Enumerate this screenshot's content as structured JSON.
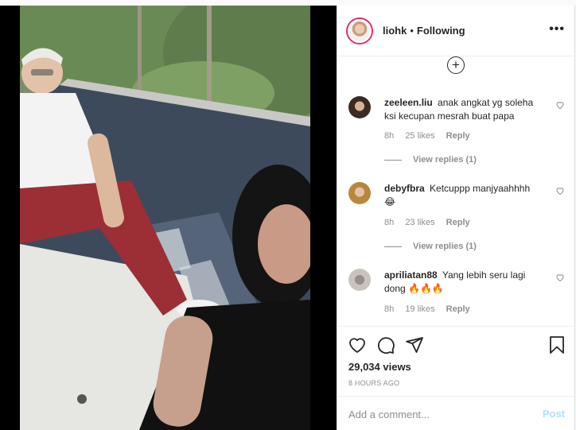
{
  "post": {
    "username": "liohk",
    "separator": "•",
    "follow_status": "Following",
    "more_icon": "more-horizontal-icon",
    "views": "29,034 views",
    "time_ago": "8 HOURS AGO"
  },
  "comments": [
    {
      "username": "zeeleen.liu",
      "text": "anak angkat yg soleha ksi kecupan mesrah buat papa",
      "age": "8h",
      "likes": "25 likes",
      "reply_label": "Reply",
      "view_replies": "View replies (1)"
    },
    {
      "username": "debyfbra",
      "text": "Ketcuppp manjyaahhhh 😂",
      "age": "8h",
      "likes": "23 likes",
      "reply_label": "Reply",
      "view_replies": "View replies (1)"
    },
    {
      "username": "apriliatan88",
      "text": "Yang lebih seru lagi dong 🔥🔥🔥",
      "age": "8h",
      "likes": "19 likes",
      "reply_label": "Reply"
    }
  ],
  "composer": {
    "placeholder": "Add a comment...",
    "post_label": "Post",
    "post_color": "#b2dffc"
  },
  "colors": {
    "text": "#262626",
    "muted": "#8e8e8e",
    "border": "#efefef"
  }
}
